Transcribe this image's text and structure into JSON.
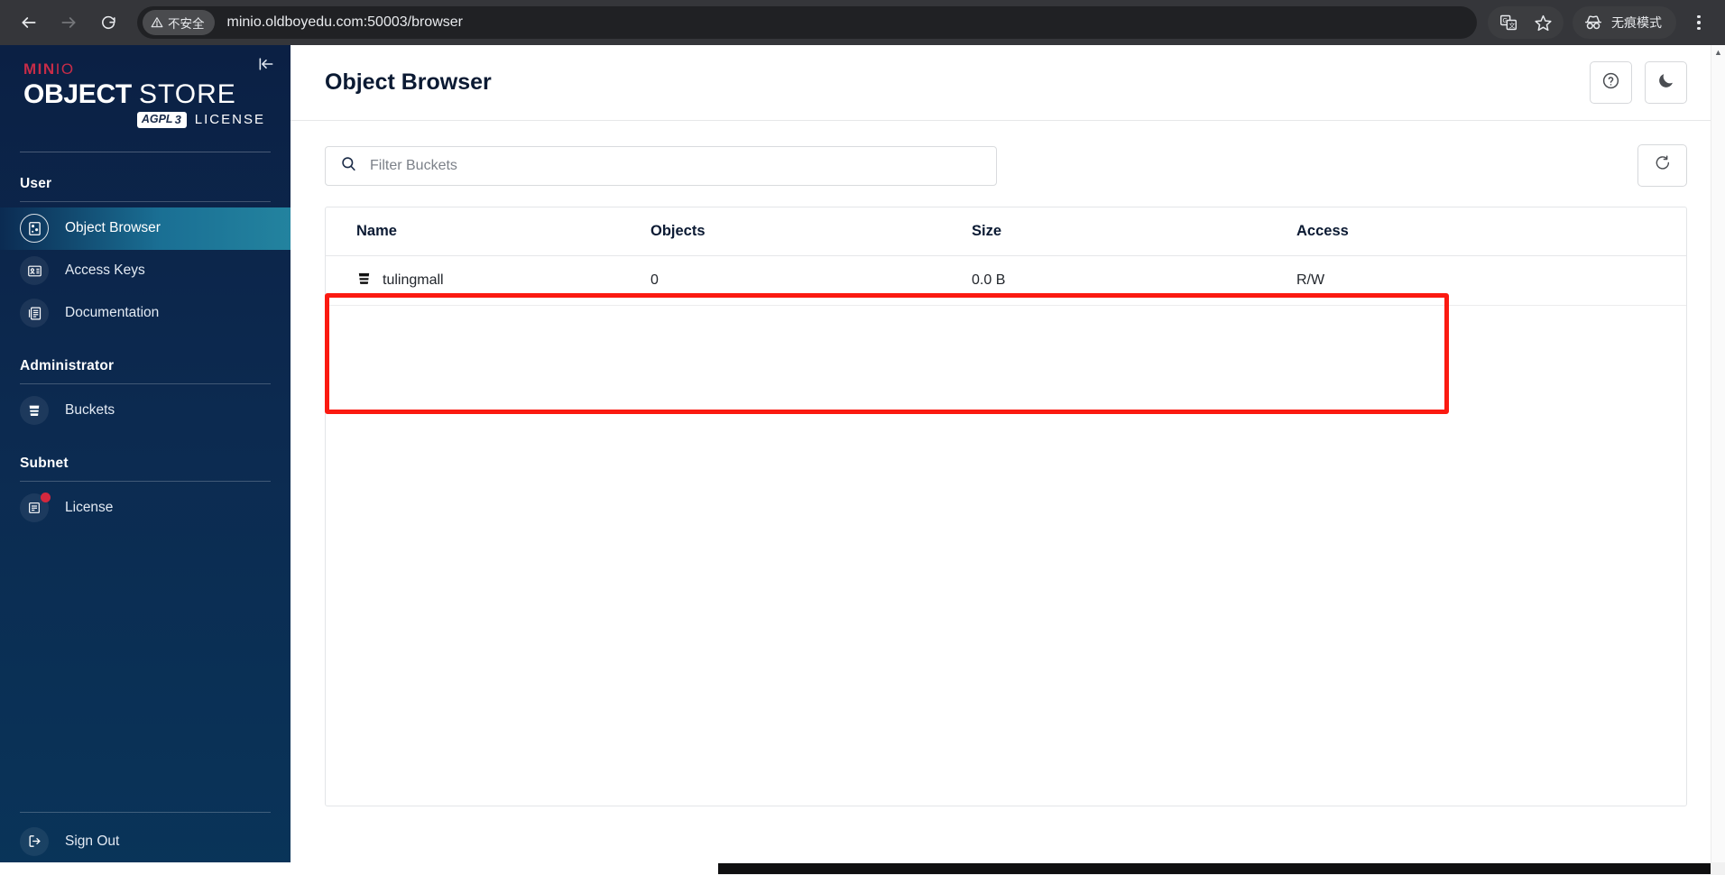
{
  "browser": {
    "back_label": "back-arrow",
    "forward_label": "forward-arrow",
    "reload_label": "reload",
    "security_badge": "不安全",
    "url": "minio.oldboyedu.com:50003/browser",
    "translate_label": "translate",
    "bookmark_label": "bookmark-star",
    "incognito_label": "无痕模式",
    "menu_label": "chrome-menu"
  },
  "sidebar": {
    "logo": {
      "brand": "MIN",
      "brand_suffix": "IO",
      "product_bold": "OBJECT",
      "product_light": "STORE",
      "agpl": "AGPL",
      "agpl_version": "3",
      "license_word": "LICENSE"
    },
    "collapse_label": "collapse-sidebar",
    "sections": [
      {
        "title": "User",
        "items": [
          {
            "label": "Object Browser",
            "icon": "object-browser-icon",
            "active": true,
            "badge": false
          },
          {
            "label": "Access Keys",
            "icon": "access-keys-icon",
            "active": false,
            "badge": false
          },
          {
            "label": "Documentation",
            "icon": "documentation-icon",
            "active": false,
            "badge": false
          }
        ]
      },
      {
        "title": "Administrator",
        "items": [
          {
            "label": "Buckets",
            "icon": "bucket-icon",
            "active": false,
            "badge": false
          }
        ]
      },
      {
        "title": "Subnet",
        "items": [
          {
            "label": "License",
            "icon": "license-icon",
            "active": false,
            "badge": true
          }
        ]
      }
    ],
    "sign_out": {
      "label": "Sign Out",
      "icon": "sign-out-icon"
    }
  },
  "header": {
    "title": "Object Browser",
    "help_label": "help-icon",
    "dark_mode_label": "dark-mode-moon-icon"
  },
  "toolbar": {
    "search_placeholder": "Filter Buckets",
    "search_value": "",
    "search_icon": "search-icon",
    "refresh_label": "refresh-icon"
  },
  "table": {
    "columns": [
      "Name",
      "Objects",
      "Size",
      "Access"
    ],
    "rows": [
      {
        "name": "tulingmall",
        "objects": "0",
        "size": "0.0 B",
        "access": "R/W",
        "icon": "bucket-icon"
      }
    ]
  },
  "annotation": {
    "type": "red-rectangle-highlight",
    "color": "#fb1a11",
    "target": "buckets-table-rows"
  },
  "colors": {
    "sidebar_top": "#0b2044",
    "sidebar_bottom": "#093459",
    "active_nav": "#23839f",
    "brand_red": "#c72c48",
    "annotation_red": "#fb1a11",
    "chrome_bar": "#35363a",
    "omnibox": "#202124"
  }
}
